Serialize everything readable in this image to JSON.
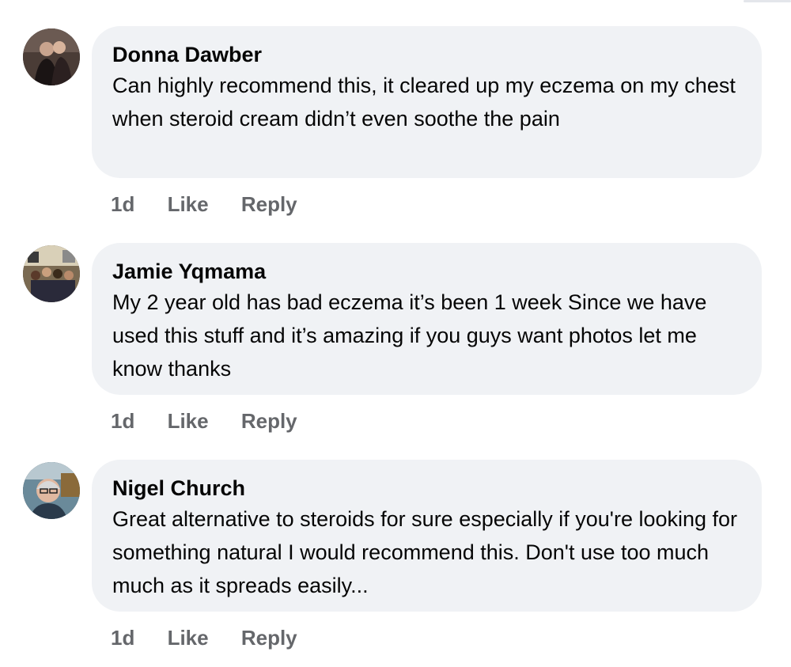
{
  "comments": [
    {
      "author": "Donna Dawber",
      "text": "Can highly recommend this, it cleared up my eczema on my chest when steroid cream didn’t even soothe the pain",
      "time": "1d",
      "like_label": "Like",
      "reply_label": "Reply"
    },
    {
      "author": "Jamie Yqmama",
      "text": "My 2 year old has bad eczema it’s been 1 week Since we have used this stuff and it’s amazing if you guys want photos let me know thanks",
      "time": "1d",
      "like_label": "Like",
      "reply_label": "Reply"
    },
    {
      "author": "Nigel Church",
      "text": "Great alternative to steroids for sure especially if you're looking for something natural I would recommend this. Don't use too much much as it spreads easily...",
      "time": "1d",
      "like_label": "Like",
      "reply_label": "Reply"
    }
  ],
  "colors": {
    "bubble_bg": "#f0f2f5",
    "text": "#050505",
    "secondary_text": "#65676b"
  },
  "icons": [
    "avatar-photo"
  ]
}
